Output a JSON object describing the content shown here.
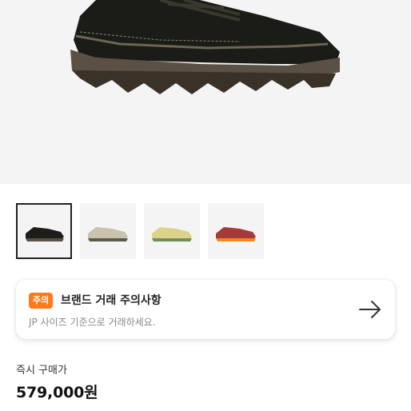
{
  "product": {
    "main_image": "shoe-black-main",
    "thumbnails": [
      {
        "name": "shoe-black",
        "selected": true
      },
      {
        "name": "shoe-beige",
        "selected": false
      },
      {
        "name": "shoe-yellow-green",
        "selected": false
      },
      {
        "name": "shoe-orange-red",
        "selected": false
      }
    ]
  },
  "notice": {
    "badge": "주의",
    "title": "브랜드 거래 주의사항",
    "description": "JP 사이즈 기준으로 거래하세요.",
    "icon": "arrow-right-icon",
    "badge_color": "#ff7a1a"
  },
  "price": {
    "label": "즉시 구매가",
    "value": "579,000원"
  }
}
